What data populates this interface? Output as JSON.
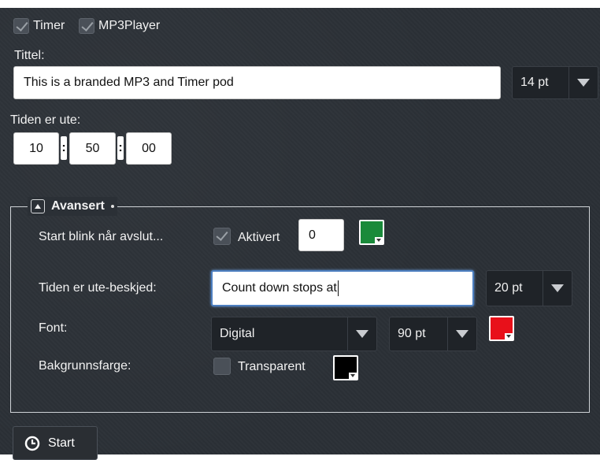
{
  "tabs": {
    "timer_label": "Timer",
    "timer_checked": true,
    "mp3_label": "MP3Player",
    "mp3_checked": true
  },
  "title": {
    "label": "Tittel:",
    "value": "This is a branded MP3 and Timer pod",
    "size": "14 pt"
  },
  "time": {
    "label": "Tiden er ute:",
    "hours": "10",
    "minutes": "50",
    "seconds": "00",
    "separator": ":"
  },
  "advanced": {
    "legend": "Avansert",
    "blink": {
      "label": "Start blink når avslut...",
      "checkbox_label": "Aktivert",
      "checked": true,
      "count": "0",
      "color": "#1a8a3a"
    },
    "message": {
      "label": "Tiden er ute-beskjed:",
      "value": "Count down stops at",
      "size": "20 pt"
    },
    "font": {
      "label": "Font:",
      "family": "Digital",
      "size": "90 pt",
      "color": "#e8101a"
    },
    "background": {
      "label": "Bakgrunnsfarge:",
      "checkbox_label": "Transparent",
      "checked": false,
      "color": "#000000"
    }
  },
  "start_button": {
    "label": "Start",
    "icon": "clock-icon"
  }
}
